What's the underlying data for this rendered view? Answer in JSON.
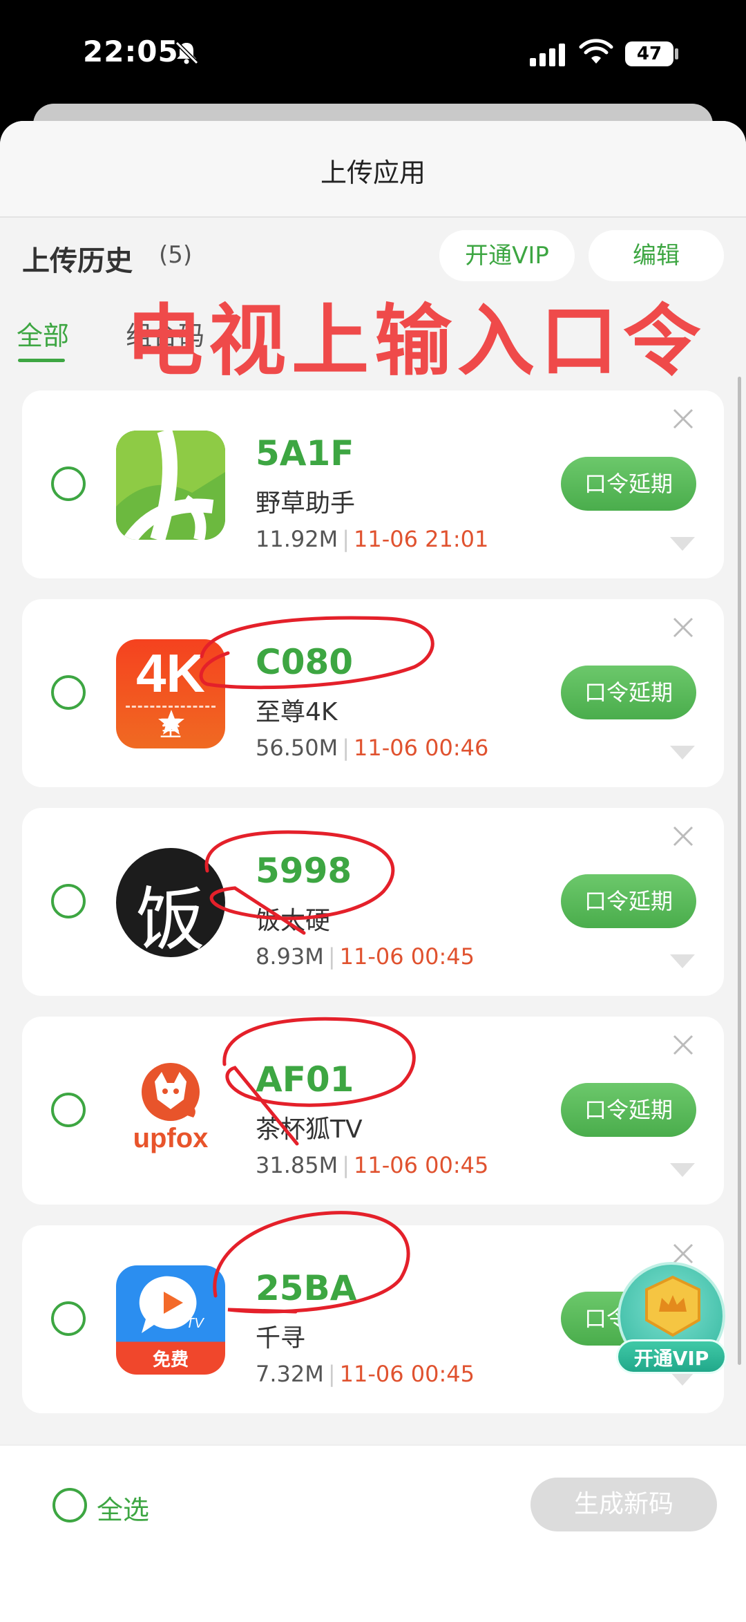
{
  "status_bar": {
    "time": "22:05",
    "battery": "47"
  },
  "header": {
    "title": "上传应用"
  },
  "history": {
    "title": "上传历史",
    "count": "(5)"
  },
  "actions": {
    "vip": "开通VIP",
    "edit": "编辑"
  },
  "tabs": [
    {
      "label": "全部"
    },
    {
      "label": "组合码"
    }
  ],
  "overlay": {
    "text": "电视上输入口令"
  },
  "apps": [
    {
      "code": "5A1F",
      "name": "野草助手",
      "size": "11.92M",
      "date": "11-06 21:01",
      "action": "口令延期",
      "icon": "grass-helper-icon"
    },
    {
      "code": "C080",
      "name": "至尊4K",
      "size": "56.50M",
      "date": "11-06 00:46",
      "action": "口令延期",
      "icon": "zhizun-4k-icon",
      "icon_text": "4K",
      "icon_subtext": "至尊"
    },
    {
      "code": "5998",
      "name": "饭太硬",
      "size": "8.93M",
      "date": "11-06 00:45",
      "action": "口令延期",
      "icon": "fantaiying-icon",
      "icon_text": "饭"
    },
    {
      "code": "AF01",
      "name": "茶杯狐TV",
      "size": "31.85M",
      "date": "11-06 00:45",
      "action": "口令延期",
      "icon": "upfox-icon",
      "icon_text": "upfox"
    },
    {
      "code": "25BA",
      "name": "千寻",
      "size": "7.32M",
      "date": "11-06 00:45",
      "action": "口令延期",
      "icon": "qianxun-tv-icon",
      "icon_text": "免费"
    }
  ],
  "footer": {
    "select_all": "全选",
    "generate": "生成新码"
  },
  "floating_vip": {
    "label": "开通VIP"
  },
  "colors": {
    "accent": "#3da642",
    "date": "#e0522f",
    "overlay": "#ef4a4a"
  }
}
